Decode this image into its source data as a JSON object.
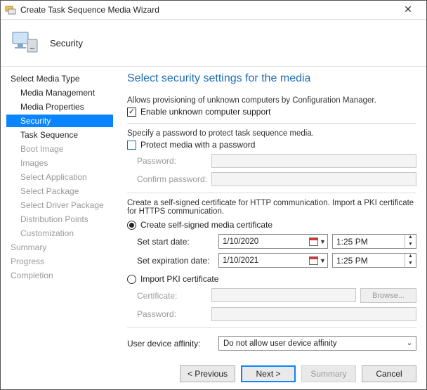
{
  "window": {
    "title": "Create Task Sequence Media Wizard"
  },
  "banner": {
    "heading": "Security"
  },
  "sidebar": {
    "select_media_type": "Select Media Type",
    "media_management": "Media Management",
    "media_properties": "Media Properties",
    "security": "Security",
    "task_sequence": "Task Sequence",
    "boot_image": "Boot Image",
    "images": "Images",
    "select_application": "Select Application",
    "select_package": "Select Package",
    "select_driver_package": "Select Driver Package",
    "distribution_points": "Distribution Points",
    "customization": "Customization",
    "summary": "Summary",
    "progress": "Progress",
    "completion": "Completion"
  },
  "main": {
    "title": "Select security settings for the media",
    "unknown_desc": "Allows provisioning of unknown computers by Configuration Manager.",
    "enable_unknown_label": "Enable unknown computer support",
    "enable_unknown_checked": true,
    "pwd_desc": "Specify a password to protect task sequence media.",
    "protect_pwd_label": "Protect media with a password",
    "protect_pwd_checked": false,
    "password_label": "Password:",
    "confirm_password_label": "Confirm password:",
    "cert_desc": "Create a self-signed certificate for HTTP communication. Import a PKI certificate for HTTPS communication.",
    "create_self_signed_label": "Create self-signed media certificate",
    "create_self_signed_selected": true,
    "start_date_label": "Set start date:",
    "start_date": "1/10/2020",
    "start_time": "1:25 PM",
    "exp_date_label": "Set expiration date:",
    "exp_date": "1/10/2021",
    "exp_time": "1:25 PM",
    "import_pki_label": "Import PKI certificate",
    "import_pki_selected": false,
    "certificate_label": "Certificate:",
    "pki_password_label": "Password:",
    "browse_label": "Browse...",
    "uda_label": "User device affinity:",
    "uda_value": "Do not allow user device affinity"
  },
  "footer": {
    "previous": "< Previous",
    "next": "Next >",
    "summary": "Summary",
    "cancel": "Cancel"
  }
}
